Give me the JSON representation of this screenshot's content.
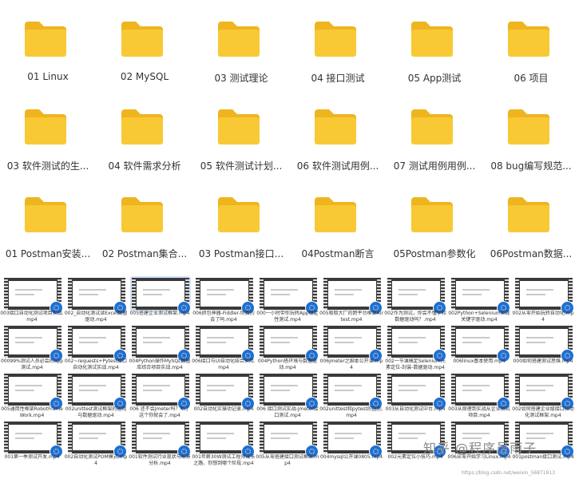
{
  "colors": {
    "folder": "#f8c935",
    "folder_tab": "#eeb51f",
    "badge": "#1f6fd1"
  },
  "folders": [
    "01 Linux",
    "02 MySQL",
    "03 测试理论",
    "04 接口测试",
    "05 App测试",
    "06 项目",
    "03 软件测试的生...",
    "04 软件需求分析",
    "05 软件测试计划...",
    "06 软件测试用例...",
    "07 测试用例用例...",
    "08 bug编写规范...",
    "01 Postman安装...",
    "02 Postman集合...",
    "03 Postman接口...",
    "04Postman断言",
    "05Postman参数化",
    "06Postman数据..."
  ],
  "videos": [
    "003接口自动化测试项目实战.mp4",
    "002_自动化测试读Excel数据驱动.mp4",
    "005搭建企业测试框架.mp4",
    "006抓包神器-Fiddler-你真的会了吗.mp4",
    "000一小时带你玩转App稳定性测试.mp4",
    "005吸取大厂的跨平台框架Airtest.mp4",
    "002作为测试，你会不懂字和数据驱动吗？.mp4",
    "002Python+Selenium实现关键字驱动.mp4",
    "002从零开始玩转自动化.mp4",
    "00099%测试人员必会的app测试.mp4",
    "002~requests+Pytest接口自动化测试实战.mp4",
    "004Python操作MySQL数据库综合项目实战.mp4",
    "006接口与UI自动化结合实用.mp4",
    "004Python搭环境与数据驱动.mp4",
    "006jmeter之脚本公开课.mp4",
    "002一节课搞定Selenium元素定位-封装-数据驱动.mp4",
    "006linux基本使用.mp4",
    "000如何搭建测试思维.mp4",
    "005通用性框架RobotFrameWork.mp4",
    "002unittest测试框架的运用与数据驱动.mp4",
    "006 还不会Jmeter吗？听了这个你就会了.mp4",
    "002自动化实操功记录.mp4",
    "006 接口测试实战-Jmeter接口测试.mp4",
    "002unittest和pytest的区别.mp4",
    "003从自动化测试中台.mp4",
    "003从原理到实战从企业测试项目.mp4",
    "002如何搭建企业级接口自动化测试框架.mp4",
    "001第一季测试开发.mp4",
    "002自动化测试POM模式.mp4",
    "001软件测试行业现状与前景分析.mp4",
    "001年薪30W测试工程师成长之路，你想到哪个阶段.mp4",
    "005从零搭建接口测试框架.mp4",
    "004mysql公开课0805.mp4",
    "002元素定位小技巧.mp4",
    "006从零开始学习Linux.mp4",
    "001postman接口测试.mp4"
  ],
  "watermark": "知乎 @程序员雨子",
  "credit": "https://blog.csdn.net/weixin_56871913"
}
